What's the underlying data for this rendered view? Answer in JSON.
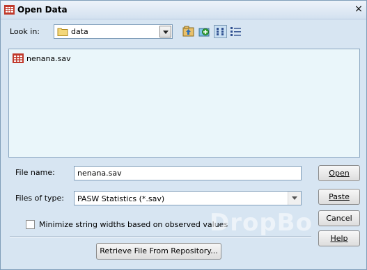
{
  "window": {
    "title": "Open Data",
    "close_symbol": "×"
  },
  "look_in": {
    "label": "Look in:",
    "value": "data"
  },
  "toolbar": {
    "icons": [
      "up-folder-icon",
      "new-folder-icon",
      "list-view-icon",
      "details-view-icon"
    ]
  },
  "file_list": {
    "items": [
      {
        "name": "nenana.sav",
        "icon": "sav-file-icon"
      }
    ]
  },
  "file_name": {
    "label": "File name:",
    "value": "nenana.sav"
  },
  "files_of_type": {
    "label": "Files of type:",
    "value": "PASW Statistics (*.sav)"
  },
  "minimize_option": {
    "label": "Minimize string widths based on observed values",
    "checked": false
  },
  "buttons": {
    "open": "Open",
    "paste": "Paste",
    "cancel": "Cancel",
    "help": "Help",
    "retrieve": "Retrieve File From Repository..."
  },
  "watermark": {
    "text": "DropBo"
  },
  "colors": {
    "dialog_bg": "#d7e5f2",
    "list_bg": "#eaf6fa",
    "border": "#7f9db9"
  }
}
